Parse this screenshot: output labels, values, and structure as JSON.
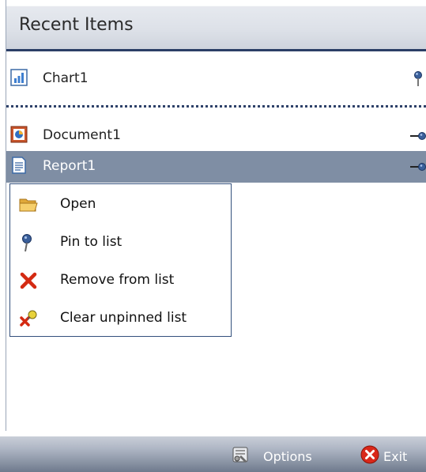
{
  "header": {
    "title": "Recent Items"
  },
  "items": {
    "chart": {
      "label": "Chart1",
      "icon": "chart-document-icon",
      "pinned": true
    },
    "document": {
      "label": "Document1",
      "icon": "document-icon",
      "pinned": false
    },
    "report": {
      "label": "Report1",
      "icon": "report-icon",
      "pinned": false,
      "selected": true
    }
  },
  "context_menu": {
    "open": {
      "label": "Open",
      "icon": "folder-icon"
    },
    "pin": {
      "label": "Pin to list",
      "icon": "pin-icon"
    },
    "remove": {
      "label": "Remove from list",
      "icon": "red-x-icon"
    },
    "clear": {
      "label": "Clear unpinned list",
      "icon": "clear-list-icon"
    }
  },
  "footer": {
    "options_label": "Options",
    "exit_label": "Exit"
  },
  "colors": {
    "header_border": "#2b3f66",
    "selected_row": "#7f8ea4",
    "menu_border": "#33507c",
    "footer_bar": "#6f7a8d"
  }
}
